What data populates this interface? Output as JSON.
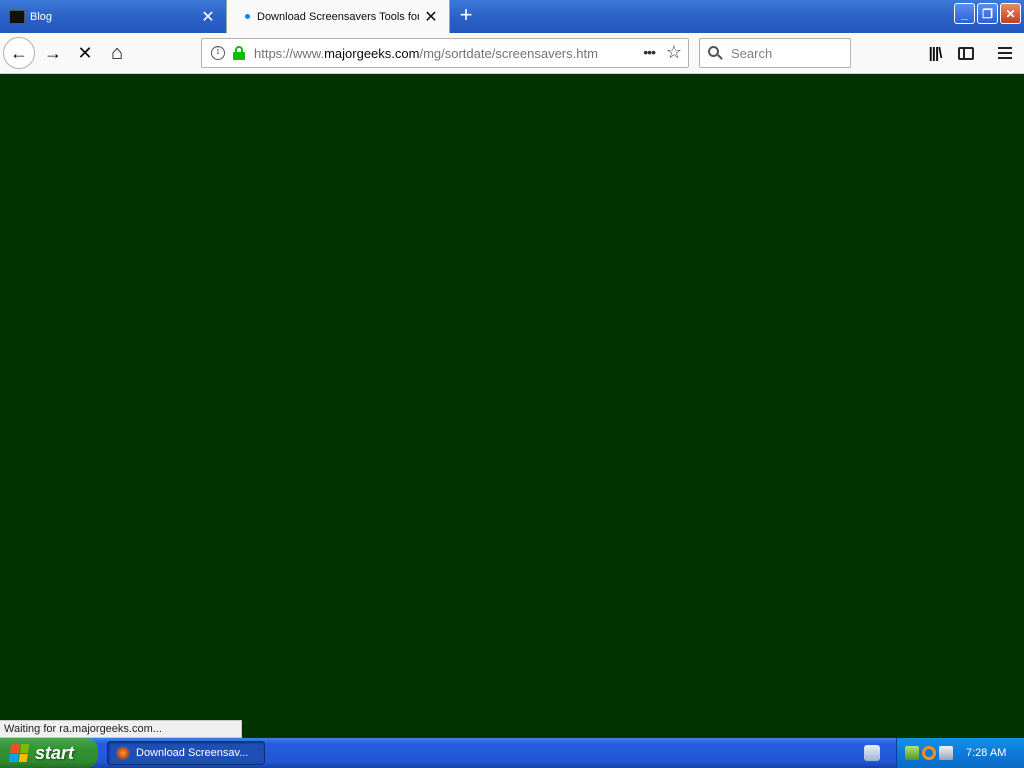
{
  "browser": {
    "tabs": [
      {
        "title": "Blog",
        "active": false
      },
      {
        "title": "Download Screensavers Tools for",
        "active": true
      }
    ],
    "new_tab_symbol": "+",
    "close_symbol": "✕",
    "window_controls": {
      "minimize": "_",
      "restore": "❐",
      "close": "✕"
    },
    "nav": {
      "back": "←",
      "forward": "→",
      "stop": "✕",
      "home": "⌂"
    },
    "url": {
      "prefix": "https://www.",
      "host": "majorgeeks.com",
      "path": "/mg/sortdate/screensavers.htm"
    },
    "page_actions": "•••",
    "bookmark_star": "☆",
    "search": {
      "placeholder": "Search"
    },
    "library": "|||\\",
    "content_background": "#003300",
    "status_text": "Waiting for ra.majorgeeks.com..."
  },
  "taskbar": {
    "start_label": "start",
    "items": [
      {
        "label": "Download Screensav..."
      }
    ],
    "clock": "7:28 AM"
  }
}
